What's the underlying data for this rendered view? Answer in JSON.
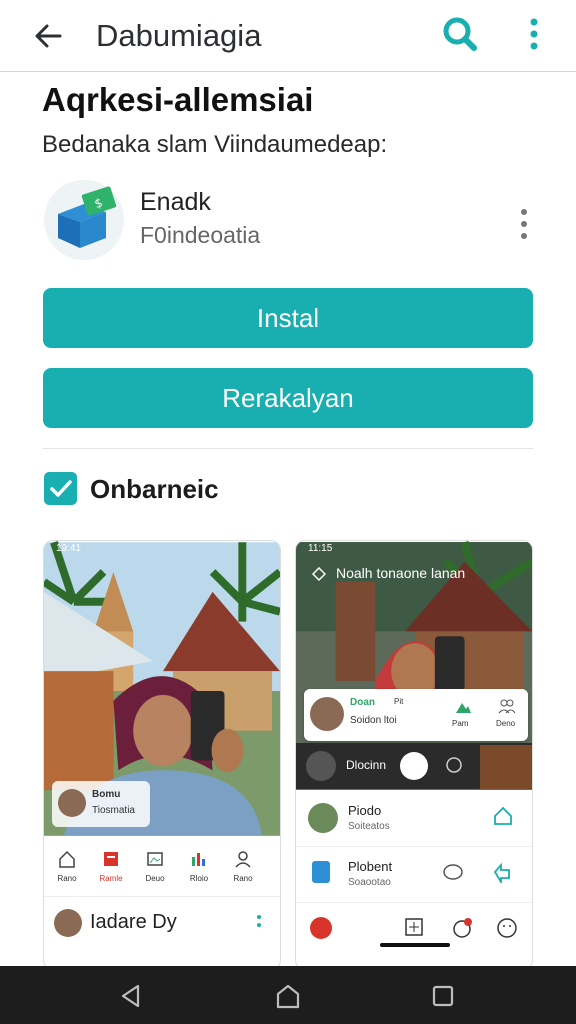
{
  "appbar": {
    "title": "Dabumiagia",
    "back_icon": "back-arrow-icon",
    "search_icon": "search-icon",
    "more_icon": "more-vert-icon"
  },
  "page": {
    "heading": "Aqrkesi-allemsiai",
    "subheading": "Bedanaka slam Viindaumedeap:"
  },
  "app": {
    "name": "Enadk",
    "developer": "F0indeoatia"
  },
  "buttons": {
    "install": "Instal",
    "second": "Rerakalyan"
  },
  "option": {
    "label": "Onbarneic",
    "checked": true
  },
  "screenshot1": {
    "status": "19:41",
    "profile_name": "Bomu",
    "profile_sub": "Tiosmatia",
    "nav": [
      "Rano",
      "Ramle",
      "Deuo",
      "Rloio",
      "Rano"
    ],
    "list_title": "Iadare Dy"
  },
  "screenshot2": {
    "status": "11:15",
    "header": "Noalh tonaone lanan",
    "card_name": "Doan",
    "card_badge": "Pit",
    "card_sub": "Soidon ltoi",
    "card_action1": "Pam",
    "card_action2": "Deno",
    "dark_label": "Dlocinn",
    "items": [
      {
        "title": "Piodo",
        "sub": "Soiteatos"
      },
      {
        "title": "Plobent",
        "sub": "Soaootao"
      }
    ]
  },
  "colors": {
    "accent": "#19aeaf",
    "navbar": "#1d1d1d"
  }
}
